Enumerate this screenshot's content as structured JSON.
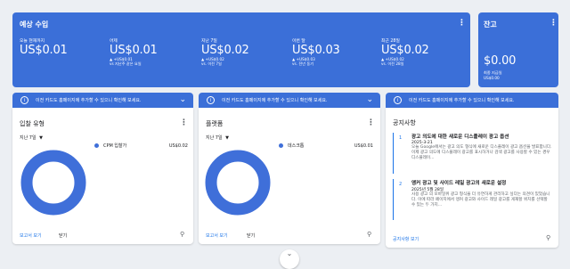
{
  "earnings": {
    "title": "예상 수입",
    "metrics": [
      {
        "label": "오늘 현재까지",
        "value": "US$0.01",
        "delta": "",
        "compare": ""
      },
      {
        "label": "어제",
        "value": "US$0.01",
        "delta": "▲ +US$0.01",
        "compare": "vs 지난주 같은 요일"
      },
      {
        "label": "지난 7일",
        "value": "US$0.02",
        "delta": "▲ +US$0.02",
        "compare": "vs. 이전 7일"
      },
      {
        "label": "이번 달",
        "value": "US$0.03",
        "delta": "▲ +US$0.03",
        "compare": "vs. 전년 동기"
      },
      {
        "label": "최근 28일",
        "value": "US$0.02",
        "delta": "▲ +US$0.02",
        "compare": "vs. 이전 28일"
      }
    ]
  },
  "balance": {
    "title": "잔고",
    "value": "$0.00",
    "last_payment_label": "최종 지급일",
    "last_payment_value": "US$0.00"
  },
  "banner_text": "이전 카드도 홈페이지에 추가할 수 있으니 확인해 보세요.",
  "card_ad_type": {
    "title": "입찰 유형",
    "range": "지난 7일",
    "legend_label": "CPM 입찰가",
    "legend_value": "US$0.02",
    "report_link": "보고서 보기",
    "close_label": "닫기"
  },
  "card_platform": {
    "title": "플랫폼",
    "range": "지난 7일",
    "legend_label": "데스크톱",
    "legend_value": "US$0.01",
    "report_link": "보고서 보기",
    "close_label": "닫기"
  },
  "card_news": {
    "title": "공지사항",
    "items": [
      {
        "num": "1",
        "headline": "광고 의도에 대한 새로운 디스플레이 광고 옵션",
        "date": "2025-3-21",
        "body": "오늘 Google에서는 광고 의도 형식에 새로운 디스플레이 광고 옵션을 발표합니다. 이제 광고 의도에 디스플레이 광고를 표시하거나 검색 광고를 사용할 수 있는 경우 디스플레이..."
      },
      {
        "num": "2",
        "headline": "앵커 광고 및 사이드 레일 광고의 새로운 설정",
        "date": "2025년 5월 28일",
        "body": "사용 광고 의 모바일위 광고 형식을 더 유연하게 관리하고 싶다는 의견이 있었습니다. 이에 따라 페이지에서 앵커 광고와 사이드 레일 광고를 게재할 위치를 선택할 수 있는 두 가지..."
      }
    ],
    "footer_link": "공지사항 보기"
  },
  "colors": {
    "accent": "#3b6fd8",
    "donut": "#3f6fd9",
    "link": "#1a73e8"
  }
}
